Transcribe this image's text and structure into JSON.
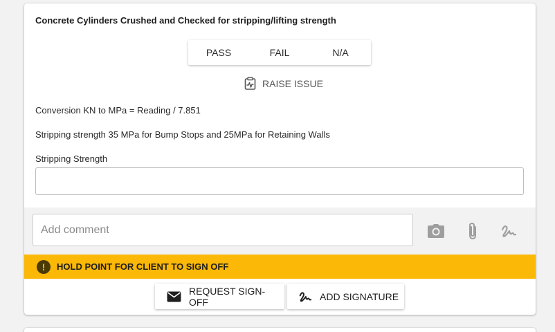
{
  "question": {
    "title": "Concrete Cylinders Crushed and Checked for stripping/lifting strength",
    "options": [
      "PASS",
      "FAIL",
      "N/A"
    ],
    "raise_issue_label": "RAISE ISSUE",
    "notes": [
      "Conversion KN to MPa = Reading / 7.851",
      "Stripping strength 35 MPa for Bump Stops and 25MPa for Retaining Walls"
    ],
    "field_label": "Stripping Strength",
    "field_value": ""
  },
  "comment": {
    "placeholder": "Add comment",
    "icons": [
      "camera-icon",
      "paperclip-icon",
      "signature-icon"
    ]
  },
  "hold_point": {
    "icon": "exclamation-icon",
    "text": "HOLD POINT FOR CLIENT TO SIGN OFF",
    "color": "#fbb806"
  },
  "actions": {
    "request_signoff_label": "REQUEST SIGN-OFF",
    "add_signature_label": "ADD SIGNATURE"
  }
}
